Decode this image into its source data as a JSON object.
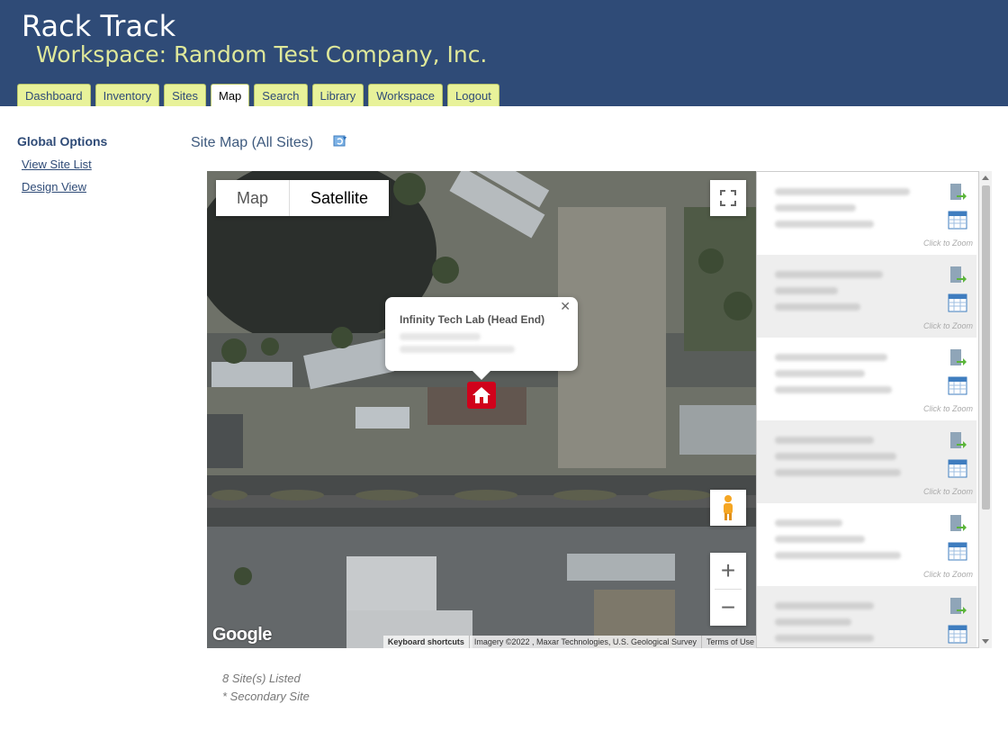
{
  "header": {
    "app_title": "Rack Track",
    "workspace_title": "Workspace: Random Test Company, Inc."
  },
  "nav": {
    "tabs": [
      {
        "label": "Dashboard",
        "active": false
      },
      {
        "label": "Inventory",
        "active": false
      },
      {
        "label": "Sites",
        "active": false
      },
      {
        "label": "Map",
        "active": true
      },
      {
        "label": "Search",
        "active": false
      },
      {
        "label": "Library",
        "active": false
      },
      {
        "label": "Workspace",
        "active": false
      },
      {
        "label": "Logout",
        "active": false
      }
    ]
  },
  "sidebar": {
    "title": "Global Options",
    "links": [
      "View Site List",
      "Design View"
    ]
  },
  "main": {
    "page_title": "Site Map (All Sites)",
    "refresh_icon": "refresh-icon"
  },
  "map": {
    "type_buttons": [
      "Map",
      "Satellite"
    ],
    "selected_type": "Satellite",
    "info_window_title": "Infinity Tech Lab (Head End)",
    "zoom_in": "+",
    "zoom_out": "−",
    "google_logo": "Google",
    "attribution": [
      "Keyboard shortcuts",
      "Imagery ©2022 , Maxar Technologies, U.S. Geological Survey",
      "Terms of Use"
    ]
  },
  "site_list": {
    "zoom_hint": "Click to Zoom",
    "row_count_visible": 6
  },
  "footer": {
    "count": "8 Site(s) Listed",
    "note": "* Secondary Site"
  }
}
